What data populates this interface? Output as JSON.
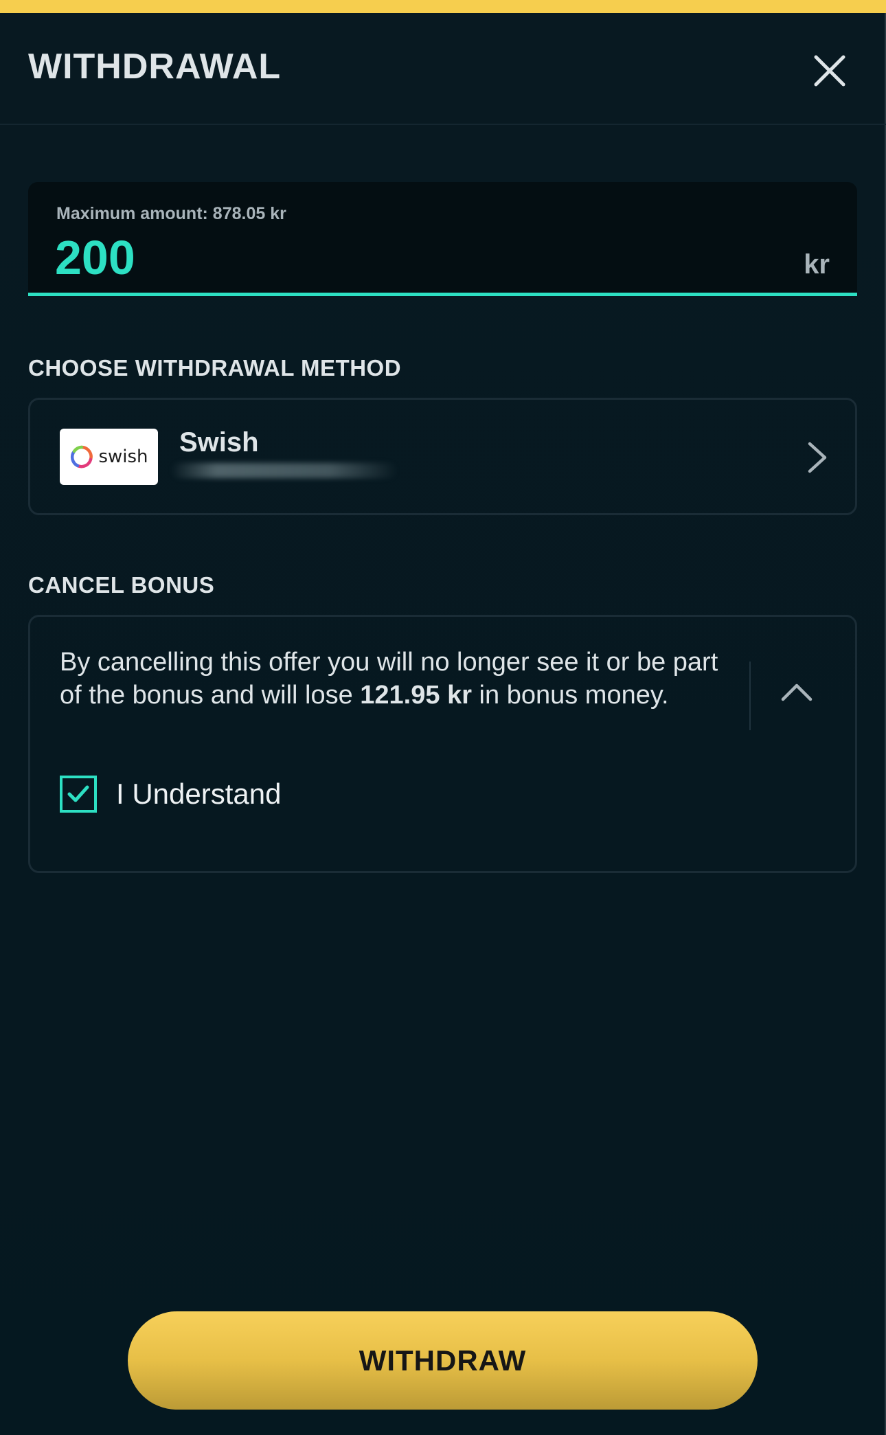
{
  "header": {
    "title": "WITHDRAWAL"
  },
  "amount": {
    "max_label": "Maximum amount: 878.05 kr",
    "value": "200",
    "currency": "kr"
  },
  "method_section": {
    "label": "CHOOSE WITHDRAWAL METHOD",
    "method": {
      "logo_text": "swish",
      "name": "Swish"
    }
  },
  "bonus_section": {
    "label": "CANCEL BONUS",
    "text_before": "By cancelling this offer you will no longer see it or be part of the bonus and will lose ",
    "amount": "121.95 kr",
    "text_after": " in bonus money.",
    "checkbox_label": "I Understand",
    "checkbox_checked": true
  },
  "footer": {
    "withdraw_label": "WITHDRAW"
  },
  "colors": {
    "accent": "#2de0c3",
    "button_yellow": "#f6ce4e",
    "background": "#081921"
  },
  "icons": {
    "close": "close-icon",
    "chevron_right": "chevron-right-icon",
    "chevron_up": "chevron-up-icon",
    "check": "check-icon"
  }
}
